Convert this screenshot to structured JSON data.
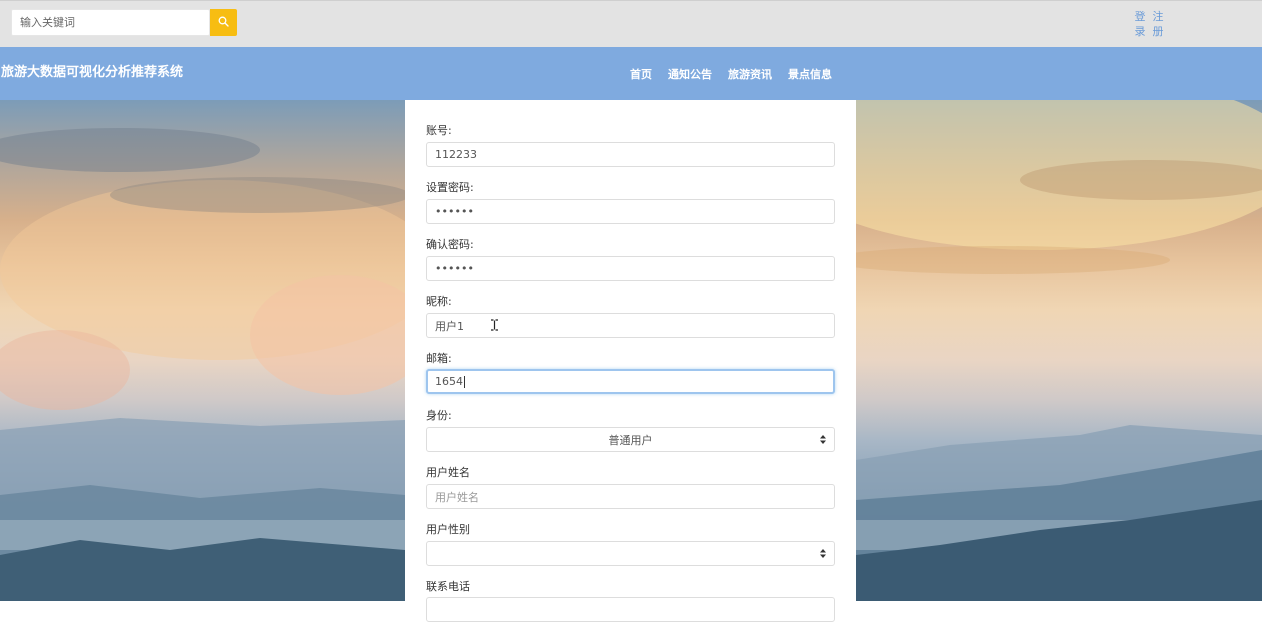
{
  "top": {
    "search_placeholder": "输入关键词",
    "login": "登录",
    "register": "注册"
  },
  "nav": {
    "site_title": "旅游大数据可视化分析推荐系统",
    "links": [
      "首页",
      "通知公告",
      "旅游资讯",
      "景点信息"
    ]
  },
  "form": {
    "account_label": "账号:",
    "account_value": "112233",
    "password_label": "设置密码:",
    "password_value": "••••••",
    "confirm_label": "确认密码:",
    "confirm_value": "••••••",
    "nickname_label": "昵称:",
    "nickname_value": "用户1",
    "email_label": "邮箱:",
    "email_value": "1654",
    "role_label": "身份:",
    "role_value": "普通用户",
    "realname_label": "用户姓名",
    "realname_placeholder": "用户姓名",
    "gender_label": "用户性别",
    "gender_value": "",
    "phone_label": "联系电话"
  },
  "colors": {
    "topbar": "#e3e3e3",
    "navbar": "#7faadf",
    "search_button": "#f7bd12",
    "auth_link": "#6a9bd8",
    "focus_border": "#9ec5ee"
  },
  "icons": {
    "search": "search-icon",
    "select_arrows": "sort-arrows-icon",
    "text_cursor": "i-beam-cursor-icon"
  }
}
